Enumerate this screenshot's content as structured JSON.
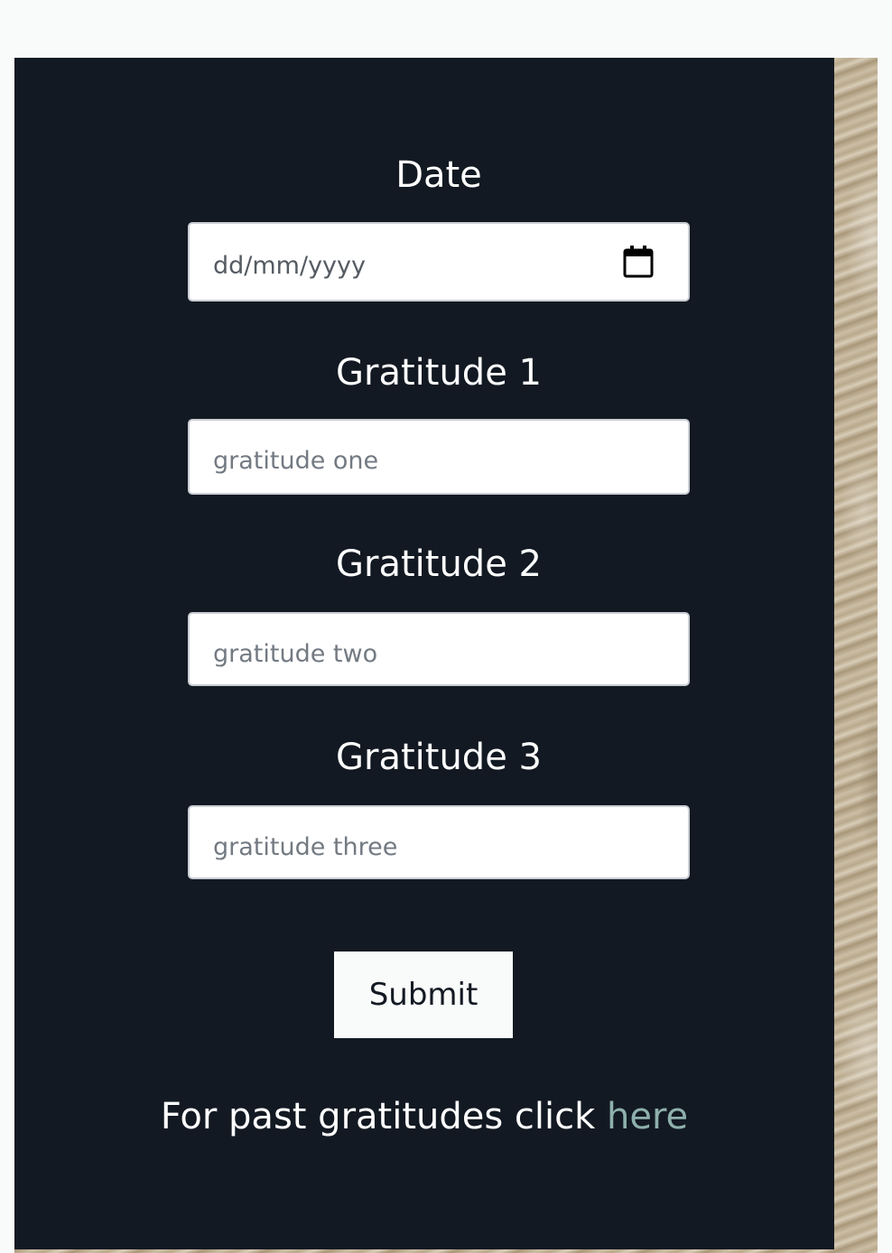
{
  "form": {
    "date": {
      "label": "Date",
      "placeholder": "dd/mm/yyyy"
    },
    "gratitude_1": {
      "label": "Gratitude 1",
      "placeholder": "gratitude one"
    },
    "gratitude_2": {
      "label": "Gratitude 2",
      "placeholder": "gratitude two"
    },
    "gratitude_3": {
      "label": "Gratitude 3",
      "placeholder": "gratitude three"
    },
    "submit_label": "Submit"
  },
  "footer": {
    "prefix": "For past gratitudes click ",
    "link_label": "here"
  },
  "colors": {
    "panel": "#121922",
    "link": "#8eb0ad",
    "button_bg": "#f9fafa"
  }
}
